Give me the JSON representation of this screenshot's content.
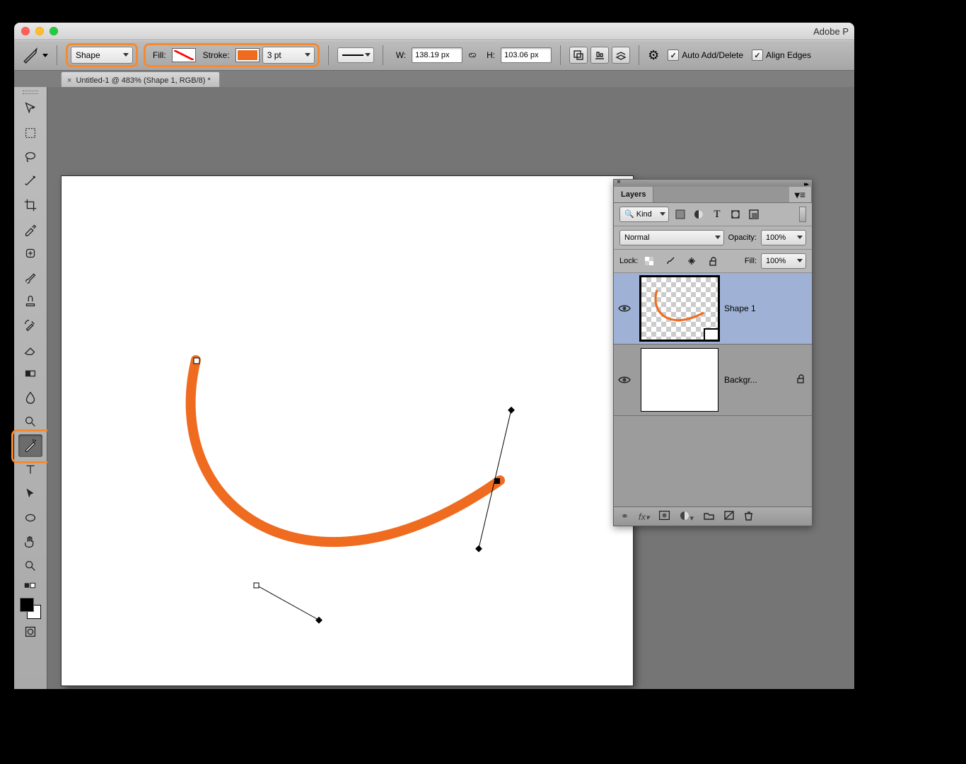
{
  "app": {
    "title": "Adobe P"
  },
  "document": {
    "tab_label": "Untitled-1 @ 483% (Shape 1, RGB/8) *"
  },
  "optbar": {
    "mode": "Shape",
    "fill_label": "Fill:",
    "stroke_label": "Stroke:",
    "stroke_weight": "3 pt",
    "w_label": "W:",
    "width": "138.19 px",
    "h_label": "H:",
    "height": "103.06 px",
    "auto_add_delete": "Auto Add/Delete",
    "align_edges": "Align Edges",
    "stroke_color": "#ef6b1f"
  },
  "layers_panel": {
    "title": "Layers",
    "filter": "Kind",
    "blend_mode": "Normal",
    "opacity_label": "Opacity:",
    "opacity": "100%",
    "lock_label": "Lock:",
    "fill_label": "Fill:",
    "fill": "100%",
    "layers": [
      {
        "name": "Shape 1",
        "selected": true,
        "kind": "vector"
      },
      {
        "name": "Backgr...",
        "selected": false,
        "kind": "raster",
        "locked": true
      }
    ]
  }
}
